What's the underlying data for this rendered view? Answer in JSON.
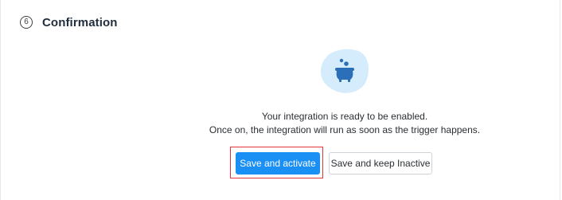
{
  "step": {
    "number": "6",
    "title": "Confirmation"
  },
  "illustration": {
    "icon": "cauldron-icon",
    "blob_color": "#d4ecfb",
    "icon_color": "#2a6fb8"
  },
  "message": {
    "line1": "Your integration is ready to be enabled.",
    "line2": "Once on, the integration will run as soon as the trigger happens."
  },
  "actions": {
    "save_activate_label": "Save and activate",
    "save_inactive_label": "Save and keep Inactive"
  },
  "colors": {
    "primary": "#1a90f5",
    "highlight": "#e3343b"
  }
}
